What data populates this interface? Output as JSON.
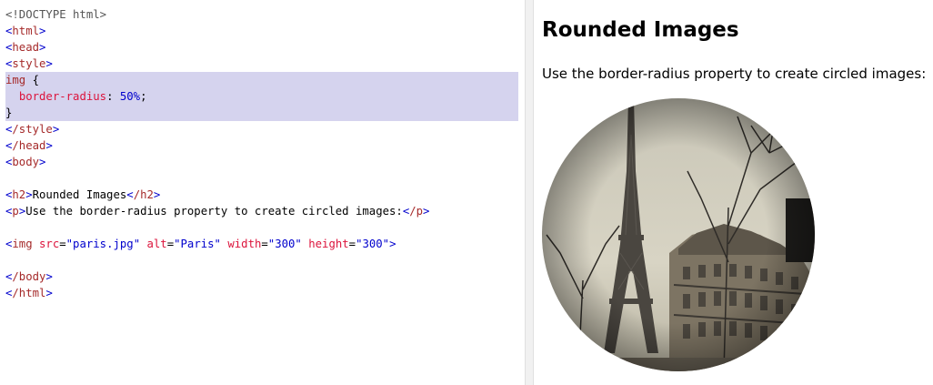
{
  "editor": {
    "lines": [
      "<!DOCTYPE html>",
      "<html>",
      "<head>",
      "<style>",
      "img {",
      "  border-radius: 50%;",
      "}",
      "</style>",
      "</head>",
      "<body>",
      "",
      "<h2>Rounded Images</h2>",
      "<p>Use the border-radius property to create circled images:</p>",
      "",
      "<img src=\"paris.jpg\" alt=\"Paris\" width=\"300\" height=\"300\">",
      "",
      "</body>",
      "</html>"
    ]
  },
  "result": {
    "heading": "Rounded Images",
    "paragraph": "Use the border-radius property to create circled images:",
    "image_alt": "Paris"
  },
  "colors": {
    "highlight": "#d5d3ee",
    "tag": "#a52a2a",
    "bracket": "#0000cd",
    "property": "#dc143c"
  }
}
